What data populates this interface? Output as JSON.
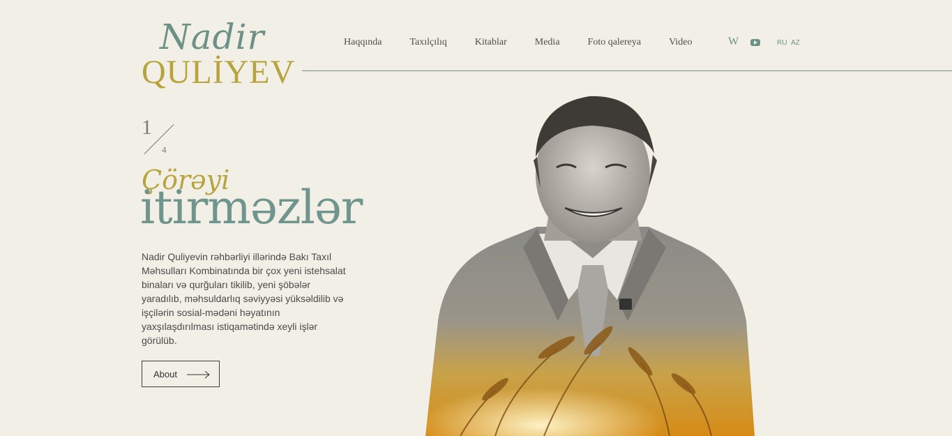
{
  "logo": {
    "script_text": "Nadir",
    "caps_text": "QULİYEV",
    "colors": {
      "script": "#6d9187",
      "caps": "#b7a43e"
    }
  },
  "nav": {
    "items": [
      {
        "label": "Haqqında"
      },
      {
        "label": "Taxılçılıq"
      },
      {
        "label": "Kitablar"
      },
      {
        "label": "Media"
      },
      {
        "label": "Foto qalereya"
      },
      {
        "label": "Video"
      }
    ]
  },
  "social": {
    "wikipedia": {
      "icon": "wikipedia-icon",
      "label": "W"
    },
    "youtube": {
      "icon": "youtube-icon"
    }
  },
  "languages": [
    "RU",
    "AZ"
  ],
  "slider": {
    "current": "1",
    "total": "4"
  },
  "hero": {
    "title_small": "Çörəyi",
    "title_big": "itirməzlər",
    "description": "Nadir Quliyevin rəhbərliyi illərində Bakı Taxıl Məhsulları Kombinatında bir çox yeni istehsalat binaları və qurğuları tikilib, yeni şöbələr yaradılıb, məhsuldarlıq səviyyəsi yüksəldilib və işçilərin sosial-mədəni həyatının yaxşılaşdırılması istiqamətində xeyli işlər görülüb.",
    "button_label": "About",
    "button_icon": "arrow-right-icon",
    "image": "portrait-with-wheat-field"
  },
  "theme": {
    "background": "#f2efe6",
    "accent_green": "#6f958c",
    "accent_gold": "#b7a43e"
  }
}
